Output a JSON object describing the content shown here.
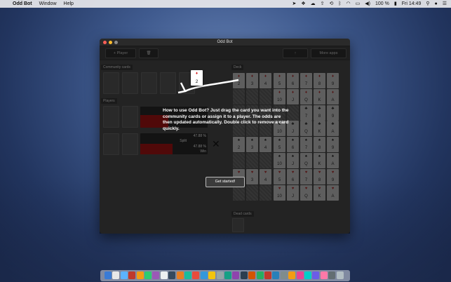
{
  "menubar": {
    "app_name": "Odd Bot",
    "menus": [
      "Window",
      "Help"
    ],
    "battery": "100 %",
    "clock": "Fri 14:49"
  },
  "window": {
    "title": "Odd Bot",
    "toolbar": {
      "add_player": "+ Player",
      "share_label": "↑",
      "more_apps": "More apps"
    }
  },
  "sections": {
    "community": "Community cards",
    "players": "Players",
    "deck": "Deck",
    "dead": "Dead cards"
  },
  "players": [
    {
      "odds": "",
      "result": ""
    },
    {
      "odds": "47.88 %",
      "result": "Split",
      "odds2": "47.88 %",
      "result2": "Win"
    }
  ],
  "dragged_card": {
    "suit": "♦",
    "rank": "2"
  },
  "deck_rows": [
    {
      "suit": "♦",
      "color": "red",
      "ranks": [
        "2",
        "3",
        "4",
        "5",
        "6",
        "7",
        "8",
        "9"
      ]
    },
    {
      "suit": "♦",
      "color": "red",
      "ranks": [
        "",
        "",
        "",
        "10",
        "J",
        "Q",
        "K",
        "A"
      ]
    },
    {
      "suit": "♣",
      "color": "black",
      "ranks": [
        "",
        "",
        "",
        "",
        "",
        "7",
        "8",
        "9"
      ]
    },
    {
      "suit": "♣",
      "color": "black",
      "ranks": [
        "",
        "",
        "",
        "10",
        "J",
        "Q",
        "K",
        "A"
      ]
    },
    {
      "suit": "♠",
      "color": "black",
      "ranks": [
        "2",
        "3",
        "4",
        "5",
        "6",
        "7",
        "8",
        "9"
      ]
    },
    {
      "suit": "♠",
      "color": "black",
      "ranks": [
        "",
        "",
        "",
        "10",
        "J",
        "Q",
        "K",
        "A"
      ]
    },
    {
      "suit": "♥",
      "color": "red",
      "ranks": [
        "2",
        "3",
        "4",
        "5",
        "6",
        "7",
        "8",
        "9"
      ]
    },
    {
      "suit": "♥",
      "color": "red",
      "ranks": [
        "",
        "",
        "",
        "10",
        "J",
        "Q",
        "K",
        "A"
      ]
    }
  ],
  "tutorial": {
    "text": "How to use Odd Bot? Just drag the card you want into the community cards or assign it to a player. The odds are then updated automatically. Double click to remove a card quickly.",
    "button": "Get started!"
  }
}
